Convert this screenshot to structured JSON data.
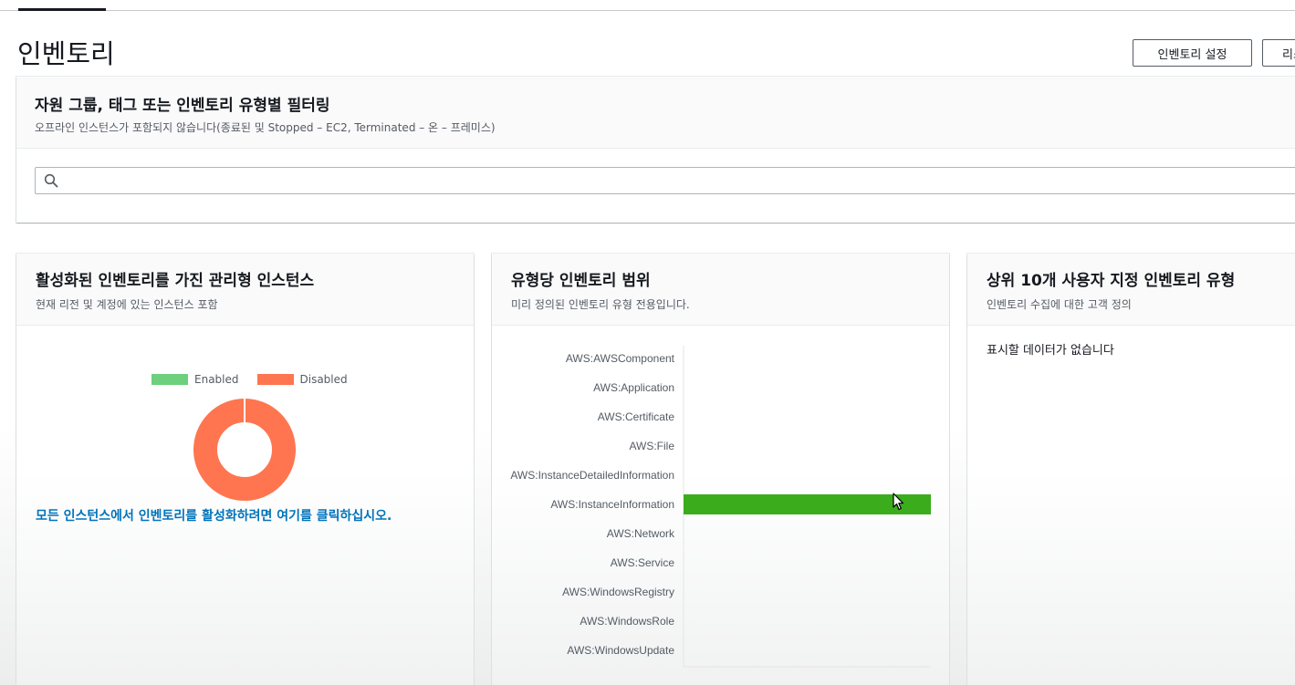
{
  "page": {
    "title": "인벤토리",
    "buttons": {
      "settings": "인벤토리 설정",
      "second": "리소"
    }
  },
  "filter": {
    "title": "자원 그룹, 태그 또는 인벤토리 유형별 필터링",
    "subtitle": "오프라인 인스턴스가 포함되지 않습니다(종료된 및 Stopped – EC2, Terminated – 온 – 프레미스)",
    "search_value": ""
  },
  "cards": {
    "managed": {
      "title": "활성화된 인벤토리를 가진 관리형 인스턴스",
      "subtitle": "현재 리전 및 계정에 있는 인스턴스 포함",
      "link": "모든 인스턴스에서 인벤토리를 활성화하려면 여기를 클릭하십시오."
    },
    "coverage": {
      "title": "유형당 인벤토리 범위",
      "subtitle": "미리 정의된 인벤토리 유형 전용입니다."
    },
    "custom": {
      "title": "상위 10개 사용자 지정 인벤토리 유형",
      "subtitle": "인벤토리 수집에 대한 고객 정의",
      "empty": "표시할 데이터가 없습니다"
    }
  },
  "colors": {
    "enabled": "#6cd07d",
    "disabled": "#ff7550",
    "bar": "#3bac1c",
    "link": "#0073bb"
  },
  "chart_data": [
    {
      "type": "pie",
      "categories": [
        "Enabled",
        "Disabled"
      ],
      "values": [
        0,
        100
      ],
      "legend": "top"
    },
    {
      "type": "bar",
      "orientation": "horizontal",
      "categories": [
        "AWS:AWSComponent",
        "AWS:Application",
        "AWS:Certificate",
        "AWS:File",
        "AWS:InstanceDetailedInformation",
        "AWS:InstanceInformation",
        "AWS:Network",
        "AWS:Service",
        "AWS:WindowsRegistry",
        "AWS:WindowsRole",
        "AWS:WindowsUpdate"
      ],
      "values": [
        0,
        0,
        0,
        0,
        0,
        100,
        0,
        0,
        0,
        0,
        0
      ],
      "xlim": [
        0,
        100
      ]
    }
  ]
}
